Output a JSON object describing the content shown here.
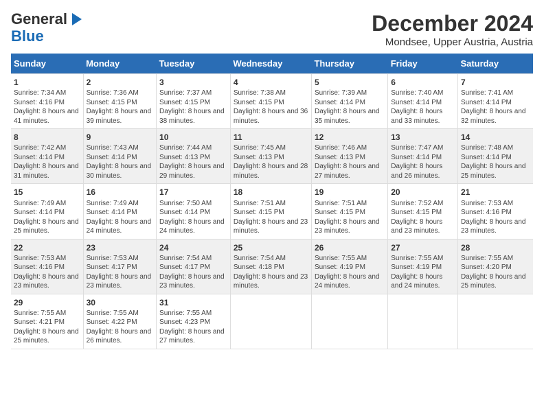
{
  "header": {
    "logo_general": "General",
    "logo_blue": "Blue",
    "title": "December 2024",
    "subtitle": "Mondsee, Upper Austria, Austria"
  },
  "days_of_week": [
    "Sunday",
    "Monday",
    "Tuesday",
    "Wednesday",
    "Thursday",
    "Friday",
    "Saturday"
  ],
  "weeks": [
    [
      {
        "day": "1",
        "sunrise": "Sunrise: 7:34 AM",
        "sunset": "Sunset: 4:16 PM",
        "daylight": "Daylight: 8 hours and 41 minutes."
      },
      {
        "day": "2",
        "sunrise": "Sunrise: 7:36 AM",
        "sunset": "Sunset: 4:15 PM",
        "daylight": "Daylight: 8 hours and 39 minutes."
      },
      {
        "day": "3",
        "sunrise": "Sunrise: 7:37 AM",
        "sunset": "Sunset: 4:15 PM",
        "daylight": "Daylight: 8 hours and 38 minutes."
      },
      {
        "day": "4",
        "sunrise": "Sunrise: 7:38 AM",
        "sunset": "Sunset: 4:15 PM",
        "daylight": "Daylight: 8 hours and 36 minutes."
      },
      {
        "day": "5",
        "sunrise": "Sunrise: 7:39 AM",
        "sunset": "Sunset: 4:14 PM",
        "daylight": "Daylight: 8 hours and 35 minutes."
      },
      {
        "day": "6",
        "sunrise": "Sunrise: 7:40 AM",
        "sunset": "Sunset: 4:14 PM",
        "daylight": "Daylight: 8 hours and 33 minutes."
      },
      {
        "day": "7",
        "sunrise": "Sunrise: 7:41 AM",
        "sunset": "Sunset: 4:14 PM",
        "daylight": "Daylight: 8 hours and 32 minutes."
      }
    ],
    [
      {
        "day": "8",
        "sunrise": "Sunrise: 7:42 AM",
        "sunset": "Sunset: 4:14 PM",
        "daylight": "Daylight: 8 hours and 31 minutes."
      },
      {
        "day": "9",
        "sunrise": "Sunrise: 7:43 AM",
        "sunset": "Sunset: 4:14 PM",
        "daylight": "Daylight: 8 hours and 30 minutes."
      },
      {
        "day": "10",
        "sunrise": "Sunrise: 7:44 AM",
        "sunset": "Sunset: 4:13 PM",
        "daylight": "Daylight: 8 hours and 29 minutes."
      },
      {
        "day": "11",
        "sunrise": "Sunrise: 7:45 AM",
        "sunset": "Sunset: 4:13 PM",
        "daylight": "Daylight: 8 hours and 28 minutes."
      },
      {
        "day": "12",
        "sunrise": "Sunrise: 7:46 AM",
        "sunset": "Sunset: 4:13 PM",
        "daylight": "Daylight: 8 hours and 27 minutes."
      },
      {
        "day": "13",
        "sunrise": "Sunrise: 7:47 AM",
        "sunset": "Sunset: 4:14 PM",
        "daylight": "Daylight: 8 hours and 26 minutes."
      },
      {
        "day": "14",
        "sunrise": "Sunrise: 7:48 AM",
        "sunset": "Sunset: 4:14 PM",
        "daylight": "Daylight: 8 hours and 25 minutes."
      }
    ],
    [
      {
        "day": "15",
        "sunrise": "Sunrise: 7:49 AM",
        "sunset": "Sunset: 4:14 PM",
        "daylight": "Daylight: 8 hours and 25 minutes."
      },
      {
        "day": "16",
        "sunrise": "Sunrise: 7:49 AM",
        "sunset": "Sunset: 4:14 PM",
        "daylight": "Daylight: 8 hours and 24 minutes."
      },
      {
        "day": "17",
        "sunrise": "Sunrise: 7:50 AM",
        "sunset": "Sunset: 4:14 PM",
        "daylight": "Daylight: 8 hours and 24 minutes."
      },
      {
        "day": "18",
        "sunrise": "Sunrise: 7:51 AM",
        "sunset": "Sunset: 4:15 PM",
        "daylight": "Daylight: 8 hours and 23 minutes."
      },
      {
        "day": "19",
        "sunrise": "Sunrise: 7:51 AM",
        "sunset": "Sunset: 4:15 PM",
        "daylight": "Daylight: 8 hours and 23 minutes."
      },
      {
        "day": "20",
        "sunrise": "Sunrise: 7:52 AM",
        "sunset": "Sunset: 4:15 PM",
        "daylight": "Daylight: 8 hours and 23 minutes."
      },
      {
        "day": "21",
        "sunrise": "Sunrise: 7:53 AM",
        "sunset": "Sunset: 4:16 PM",
        "daylight": "Daylight: 8 hours and 23 minutes."
      }
    ],
    [
      {
        "day": "22",
        "sunrise": "Sunrise: 7:53 AM",
        "sunset": "Sunset: 4:16 PM",
        "daylight": "Daylight: 8 hours and 23 minutes."
      },
      {
        "day": "23",
        "sunrise": "Sunrise: 7:53 AM",
        "sunset": "Sunset: 4:17 PM",
        "daylight": "Daylight: 8 hours and 23 minutes."
      },
      {
        "day": "24",
        "sunrise": "Sunrise: 7:54 AM",
        "sunset": "Sunset: 4:17 PM",
        "daylight": "Daylight: 8 hours and 23 minutes."
      },
      {
        "day": "25",
        "sunrise": "Sunrise: 7:54 AM",
        "sunset": "Sunset: 4:18 PM",
        "daylight": "Daylight: 8 hours and 23 minutes."
      },
      {
        "day": "26",
        "sunrise": "Sunrise: 7:55 AM",
        "sunset": "Sunset: 4:19 PM",
        "daylight": "Daylight: 8 hours and 24 minutes."
      },
      {
        "day": "27",
        "sunrise": "Sunrise: 7:55 AM",
        "sunset": "Sunset: 4:19 PM",
        "daylight": "Daylight: 8 hours and 24 minutes."
      },
      {
        "day": "28",
        "sunrise": "Sunrise: 7:55 AM",
        "sunset": "Sunset: 4:20 PM",
        "daylight": "Daylight: 8 hours and 25 minutes."
      }
    ],
    [
      {
        "day": "29",
        "sunrise": "Sunrise: 7:55 AM",
        "sunset": "Sunset: 4:21 PM",
        "daylight": "Daylight: 8 hours and 25 minutes."
      },
      {
        "day": "30",
        "sunrise": "Sunrise: 7:55 AM",
        "sunset": "Sunset: 4:22 PM",
        "daylight": "Daylight: 8 hours and 26 minutes."
      },
      {
        "day": "31",
        "sunrise": "Sunrise: 7:55 AM",
        "sunset": "Sunset: 4:23 PM",
        "daylight": "Daylight: 8 hours and 27 minutes."
      },
      null,
      null,
      null,
      null
    ]
  ]
}
